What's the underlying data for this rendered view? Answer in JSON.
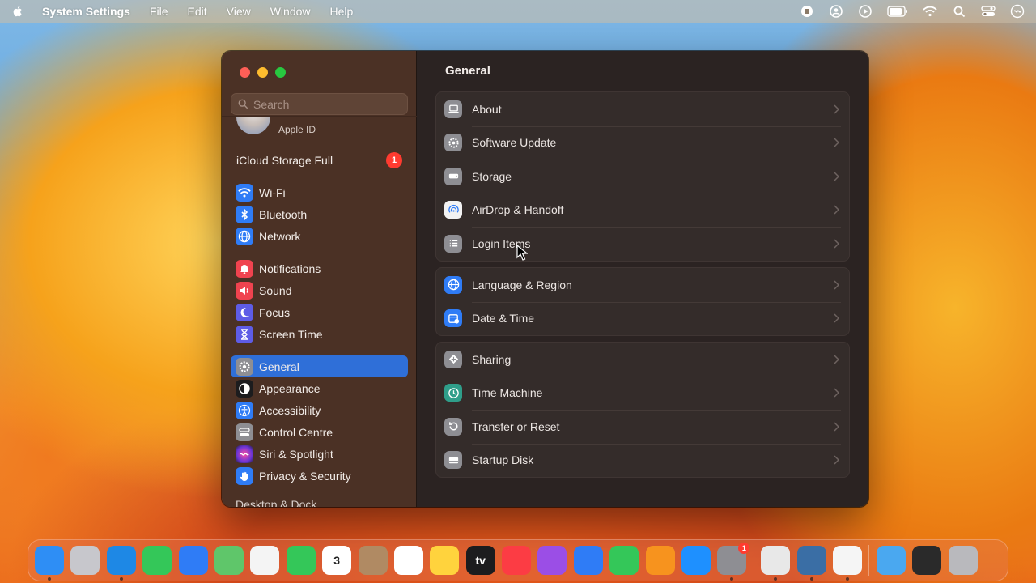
{
  "menubar": {
    "app_name": "System Settings",
    "items": [
      "File",
      "Edit",
      "View",
      "Window",
      "Help"
    ],
    "status_icons": [
      "record-icon",
      "user-icon",
      "play-icon",
      "battery-icon",
      "wifi-icon",
      "search-icon",
      "control-centre-icon",
      "siri-icon"
    ]
  },
  "sidebar": {
    "search_placeholder": "Search",
    "apple_id_label": "Apple ID",
    "icloud": {
      "label": "iCloud Storage Full",
      "badge": "1"
    },
    "groups": [
      [
        {
          "label": "Wi-Fi",
          "icon": "wifi-icon",
          "color": "#2f7cf6"
        },
        {
          "label": "Bluetooth",
          "icon": "bluetooth-icon",
          "color": "#2f7cf6"
        },
        {
          "label": "Network",
          "icon": "globe-icon",
          "color": "#2f7cf6"
        }
      ],
      [
        {
          "label": "Notifications",
          "icon": "bell-icon",
          "color": "#f0434f"
        },
        {
          "label": "Sound",
          "icon": "speaker-icon",
          "color": "#f0434f"
        },
        {
          "label": "Focus",
          "icon": "moon-icon",
          "color": "#5e5ce6"
        },
        {
          "label": "Screen Time",
          "icon": "hourglass-icon",
          "color": "#5e5ce6"
        }
      ],
      [
        {
          "label": "General",
          "icon": "gear-icon",
          "color": "#8e8e93",
          "selected": true
        },
        {
          "label": "Appearance",
          "icon": "appearance-icon",
          "color": "#1c1c1e"
        },
        {
          "label": "Accessibility",
          "icon": "accessibility-icon",
          "color": "#2f7cf6"
        },
        {
          "label": "Control Centre",
          "icon": "toggles-icon",
          "color": "#8e8e93"
        },
        {
          "label": "Siri & Spotlight",
          "icon": "siri-icon",
          "color": "#b83ee0"
        },
        {
          "label": "Privacy & Security",
          "icon": "hand-icon",
          "color": "#2f7cf6"
        }
      ]
    ],
    "partial_item": "Desktop & Dock"
  },
  "content": {
    "title": "General",
    "cards": [
      [
        {
          "label": "About",
          "icon": "laptop-icon",
          "color": "#8e8e93"
        },
        {
          "label": "Software Update",
          "icon": "gear-badge-icon",
          "color": "#8e8e93"
        },
        {
          "label": "Storage",
          "icon": "drive-icon",
          "color": "#8e8e93"
        },
        {
          "label": "AirDrop & Handoff",
          "icon": "airdrop-icon",
          "color": "#f2f2f2"
        },
        {
          "label": "Login Items",
          "icon": "list-icon",
          "color": "#8e8e93"
        }
      ],
      [
        {
          "label": "Language & Region",
          "icon": "globe-icon",
          "color": "#2f7cf6"
        },
        {
          "label": "Date & Time",
          "icon": "calendar-clock-icon",
          "color": "#2f7cf6"
        }
      ],
      [
        {
          "label": "Sharing",
          "icon": "sharing-icon",
          "color": "#8e8e93"
        },
        {
          "label": "Time Machine",
          "icon": "time-machine-icon",
          "color": "#2f9e8a"
        },
        {
          "label": "Transfer or Reset",
          "icon": "reset-icon",
          "color": "#8e8e93"
        },
        {
          "label": "Startup Disk",
          "icon": "disk-icon",
          "color": "#8e8e93"
        }
      ]
    ]
  },
  "dock": {
    "apps": [
      {
        "name": "finder-icon",
        "color": "#2e8ef5",
        "dot": true
      },
      {
        "name": "launchpad-icon",
        "color": "#c7c7cc"
      },
      {
        "name": "safari-icon",
        "color": "#1e88e5",
        "dot": true
      },
      {
        "name": "messages-icon",
        "color": "#34c759"
      },
      {
        "name": "mail-icon",
        "color": "#2f7cf6"
      },
      {
        "name": "maps-icon",
        "color": "#5fc66a"
      },
      {
        "name": "photos-icon",
        "color": "#f4f4f4"
      },
      {
        "name": "facetime-icon",
        "color": "#34c759"
      },
      {
        "name": "calendar-icon",
        "color": "#ffffff",
        "text": "3"
      },
      {
        "name": "contacts-icon",
        "color": "#b08a63"
      },
      {
        "name": "reminders-icon",
        "color": "#ffffff"
      },
      {
        "name": "notes-icon",
        "color": "#ffd33d"
      },
      {
        "name": "tv-icon",
        "color": "#1c1c1e",
        "text": "tv"
      },
      {
        "name": "music-icon",
        "color": "#fc3c44"
      },
      {
        "name": "podcasts-icon",
        "color": "#9b4ee6"
      },
      {
        "name": "keynote-icon",
        "color": "#2f7cf6"
      },
      {
        "name": "numbers-icon",
        "color": "#34c759"
      },
      {
        "name": "pages-icon",
        "color": "#f7931e"
      },
      {
        "name": "app-store-icon",
        "color": "#1e90ff"
      },
      {
        "name": "system-settings-icon",
        "color": "#8e8e93",
        "dot": true,
        "badge": "1"
      }
    ],
    "apps_right": [
      {
        "name": "chrome-icon",
        "color": "#e8e8e8",
        "dot": true
      },
      {
        "name": "quicktime-icon",
        "color": "#3a6ea5",
        "dot": true
      },
      {
        "name": "textedit-icon",
        "color": "#f5f5f5",
        "dot": true
      }
    ],
    "apps_far": [
      {
        "name": "downloads-folder-icon",
        "color": "#4aa8f0"
      },
      {
        "name": "screenshot-thumb-icon",
        "color": "#2a2a2a"
      },
      {
        "name": "trash-icon",
        "color": "#b9b9bd"
      }
    ]
  }
}
